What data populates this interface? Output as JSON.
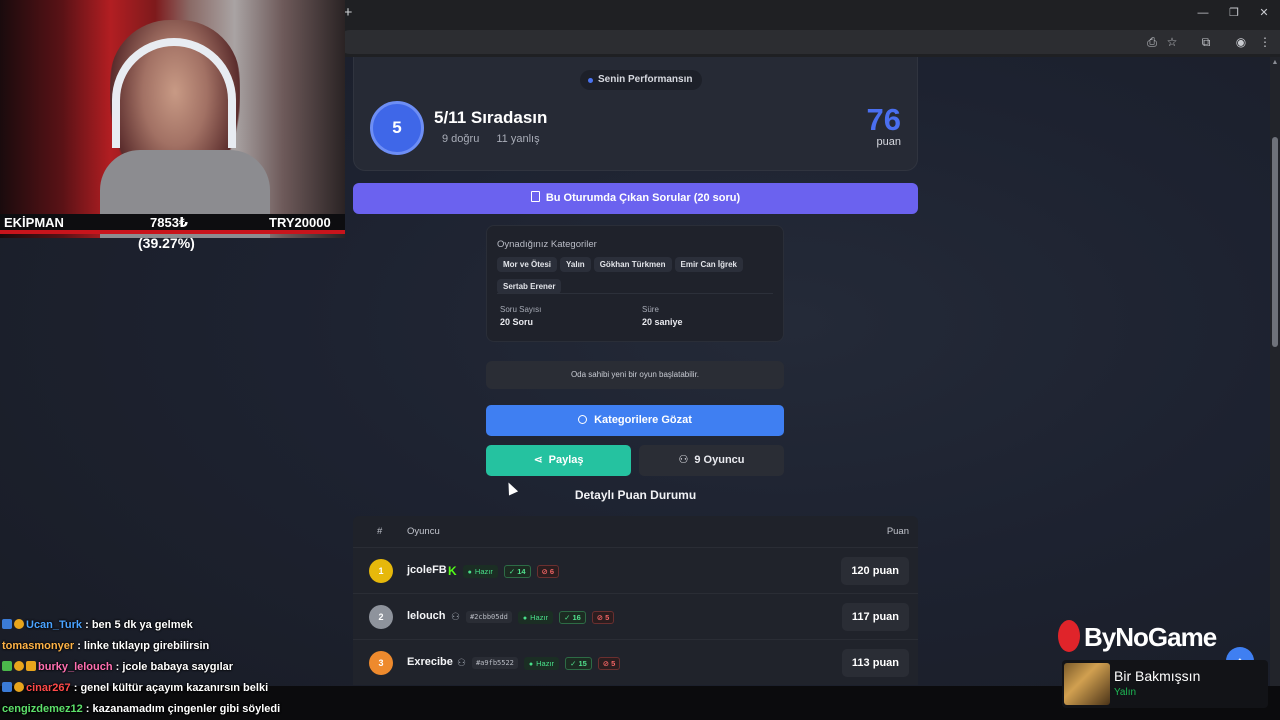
{
  "browser": {
    "new_tab_glyph": "+",
    "minimize_glyph": "—",
    "restore_glyph": "❐",
    "close_glyph": "✕",
    "menu_glyph": "⋮"
  },
  "performance": {
    "pill_label": "Senin Performansın",
    "rank_number": "5",
    "rank_title": "5/11 Sıradasın",
    "correct_text": "9 doğru",
    "wrong_text": "11 yanlış",
    "score": "76",
    "score_unit": "puan",
    "accent_color": "#4a6ff0"
  },
  "questions_button": {
    "label": "Bu Oturumda Çıkan Sorular (20 soru)"
  },
  "categories": {
    "title": "Oynadığınız Kategoriler",
    "chips": [
      "Mor ve Ötesi",
      "Yalın",
      "Gökhan Türkmen",
      "Emir Can İğrek",
      "Sertab Erener"
    ],
    "question_count_label": "Soru Sayısı",
    "question_count_value": "20 Soru",
    "duration_label": "Süre",
    "duration_value": "20 saniye"
  },
  "notice": "Oda sahibi yeni bir oyun başlatabilir.",
  "actions": {
    "browse_label": "Kategorilere Gözat",
    "share_label": "Paylaş",
    "players_label": "9 Oyuncu"
  },
  "scoreboard": {
    "title": "Detaylı Puan Durumu",
    "headers": {
      "num": "#",
      "player": "Oyuncu",
      "score": "Puan"
    },
    "rows": [
      {
        "rank": "1",
        "name": "jcoleFB",
        "tag": "",
        "status": "Hazır",
        "correct": "14",
        "wrong": "6",
        "score": "120 puan",
        "medal_color": "#e6b80b",
        "kick": true
      },
      {
        "rank": "2",
        "name": "lelouch",
        "tag": "#2cbb05dd",
        "status": "Hazır",
        "correct": "16",
        "wrong": "5",
        "score": "117 puan",
        "medal_color": "#8e939c",
        "kick": false
      },
      {
        "rank": "3",
        "name": "Exrecibe",
        "tag": "#a9fb5522",
        "status": "Hazır",
        "correct": "15",
        "wrong": "5",
        "score": "113 puan",
        "medal_color": "#ee8a2d",
        "kick": false
      }
    ]
  },
  "stream_overlay": {
    "left_label": "EKİPMAN",
    "mid_label": "7853₺",
    "right_label": "TRY20000",
    "percent": "(39.27%)"
  },
  "chat": [
    {
      "user": "Ucan_Turk",
      "color": "#4aa3ff",
      "text": ": ben 5 dk ya gelmek"
    },
    {
      "user": "tomasmonyer",
      "color": "#ffb347",
      "text": ": linke tıklayıp girebilirsin"
    },
    {
      "user": "burky_lelouch",
      "color": "#ff6fb1",
      "text": ": jcole babaya saygılar"
    },
    {
      "user": "cinar267",
      "color": "#ff4a4a",
      "text": ": genel kültür açayım kazanırsın belki"
    },
    {
      "user": "cengizdemez12",
      "color": "#5de06a",
      "text": ": kazanamadım çingenler gibi söyledi"
    }
  ],
  "now_playing": {
    "logo_text": "ByNoGame",
    "title": "Bir Bakmışsın",
    "artist": "Yalın"
  }
}
